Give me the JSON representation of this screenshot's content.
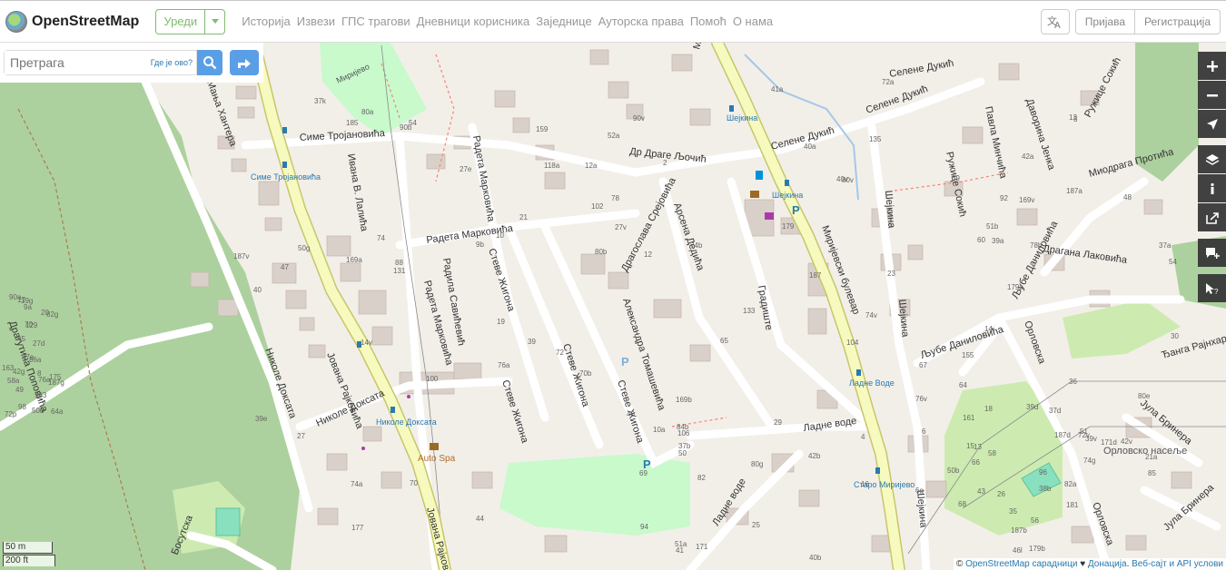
{
  "header": {
    "brand": "OpenStreetMap",
    "edit_label": "Уреди",
    "nav": [
      "Историја",
      "Извези",
      "ГПС трагови",
      "Дневници корисника",
      "Заједнице",
      "Ауторска права",
      "Помоћ",
      "О нама"
    ],
    "login": "Пријава",
    "signup": "Регистрација"
  },
  "search": {
    "placeholder": "Претрага",
    "where_am_i": "Где је ово?"
  },
  "scale": {
    "metric": "50 m",
    "imperial": "200 ft"
  },
  "attribution": {
    "copyright": "©",
    "osm_link": "OpenStreetMap сарадници",
    "heart": "♥",
    "donate_link": "Донација",
    "sep": ".",
    "terms_link": "Веб-сајт и API услови"
  },
  "colors": {
    "accent": "#7ebc6f",
    "search_button": "#5a9fe6",
    "primary_road": "#f7fabf",
    "primary_road_casing": "#c8c56a",
    "wood": "#add19e",
    "park": "#c8facc",
    "building": "#d9d0c9",
    "background": "#f2efe9"
  },
  "map": {
    "streets": [
      "Јована Рајковића",
      "Николе Доксата",
      "Симе Тројановића",
      "Радета Марковића",
      "Радила Савићевић",
      "Стеве Жигона",
      "Драгослава Срејовића",
      "Александра Томашевића",
      "Др Драге Љочић",
      "Арсена Дедића",
      "Градиште",
      "Миријевски булевар",
      "Селене Дукић",
      "Шејкина",
      "Ладне воде",
      "Љубе Даниловића",
      "Орловска",
      "Ђанга Рајнхарта",
      "Јула Бринера",
      "Босутска",
      "Драгутина Поповића",
      "Ивана В. Лалића",
      "Павла Минчића",
      "Даворина Јенка",
      "Миодрага Протића",
      "Драгана Лаковића",
      "Ружице Сокић",
      "Мања Хантера"
    ],
    "places": [
      "Миријево",
      "Орловско насеље",
      "Auto Spa"
    ],
    "bus_stops": [
      "Симе Тројановића",
      "Николе Доксата",
      "Шејкина",
      "Ладне Воде",
      "Старо Миријево"
    ],
    "house_numbers": [
      "14v",
      "118a",
      "51b",
      "51a",
      "51",
      "49",
      "54",
      "2",
      "3",
      "6g",
      "64",
      "64a",
      "40",
      "40a",
      "60",
      "66",
      "68",
      "70",
      "74",
      "72",
      "39",
      "41",
      "43",
      "129",
      "131",
      "133",
      "135",
      "4",
      "6",
      "8",
      "10",
      "12",
      "14",
      "16",
      "18",
      "20",
      "27",
      "29",
      "30",
      "35",
      "36",
      "45",
      "47",
      "65",
      "67",
      "69",
      "72v",
      "72p",
      "74a",
      "74b",
      "74v",
      "74g",
      "76v",
      "76a",
      "70",
      "70b",
      "72a",
      "84b",
      "82a",
      "82g",
      "80a",
      "80b",
      "80v",
      "80g",
      "80e",
      "90a",
      "90b",
      "90v",
      "92",
      "94",
      "96",
      "98",
      "100",
      "102",
      "104",
      "106",
      "161",
      "163",
      "169a",
      "169b",
      "169v",
      "171",
      "171d",
      "175",
      "177",
      "179",
      "179a",
      "179b",
      "181",
      "183",
      "185",
      "187",
      "187a",
      "187b",
      "187d",
      "187g",
      "187v",
      "10a",
      "12",
      "13",
      "15",
      "17",
      "19",
      "21",
      "23",
      "25",
      "26",
      "27d",
      "27e",
      "27v",
      "37a",
      "37b",
      "37d",
      "37e",
      "37k",
      "39",
      "39a",
      "39v",
      "39d",
      "39g",
      "39e",
      "41a",
      "42a",
      "42b",
      "42v",
      "42g",
      "44",
      "46",
      "48",
      "50",
      "50b",
      "50d",
      "50g",
      "52a",
      "54",
      "56",
      "58",
      "58a",
      "76a",
      "78",
      "78b",
      "82",
      "85",
      "86a",
      "88",
      "159",
      "155",
      "46l",
      "38b",
      "9a",
      "9b",
      "12a",
      "40v",
      "40b",
      "21a"
    ]
  }
}
